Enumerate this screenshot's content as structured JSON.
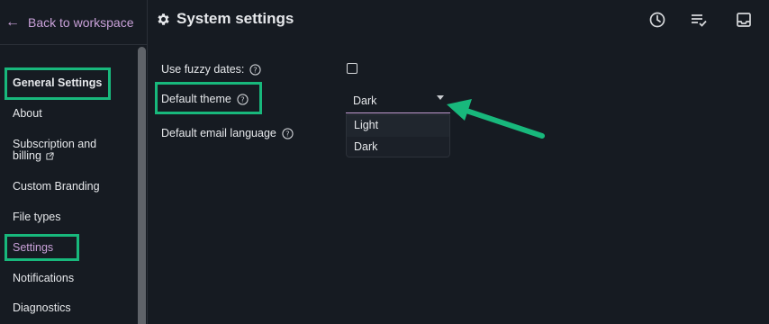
{
  "sidebar": {
    "back_label": "Back to workspace",
    "section_title": "General Settings",
    "items": [
      {
        "label": "About"
      },
      {
        "label": "Subscription and",
        "label2": "billing"
      },
      {
        "label": "Custom Branding"
      },
      {
        "label": "File types"
      },
      {
        "label": "Settings"
      },
      {
        "label": "Notifications"
      },
      {
        "label": "Diagnostics"
      }
    ]
  },
  "header": {
    "title": "System settings",
    "icons": [
      "clock-icon",
      "list-check-icon",
      "inbox-icon"
    ]
  },
  "settings": {
    "fuzzy_dates_label": "Use fuzzy dates:",
    "fuzzy_dates_checked": false,
    "theme_label": "Default theme",
    "theme_value": "Dark",
    "theme_options": [
      "Light",
      "Dark"
    ],
    "email_language_label": "Default email language"
  },
  "colors": {
    "background": "#161b22",
    "accent": "#c8a0d8",
    "highlight": "#18b87c",
    "text": "#e6e8eb"
  }
}
